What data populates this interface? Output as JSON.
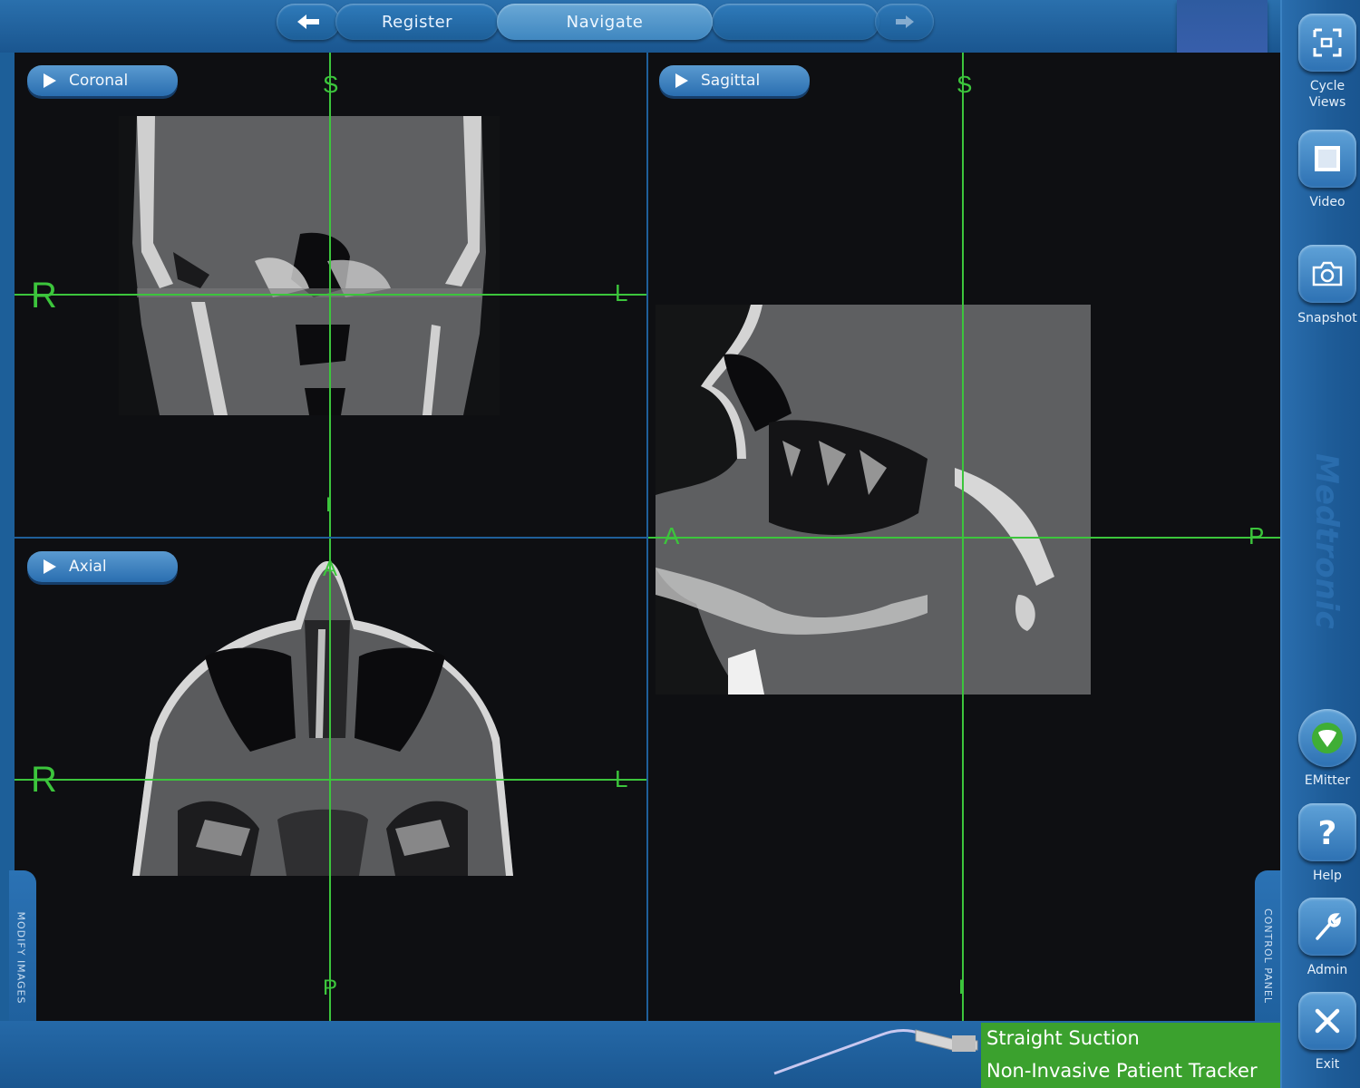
{
  "topbar": {
    "register_label": "Register",
    "navigate_label": "Navigate",
    "active_tab": "Navigate"
  },
  "views": {
    "coronal": {
      "label": "Coronal",
      "orient": {
        "top": "S",
        "left": "R",
        "right": "L",
        "bottom": "I"
      }
    },
    "sagittal": {
      "label": "Sagittal",
      "orient": {
        "top": "S",
        "left": "A",
        "right": "P",
        "bottom": "I"
      }
    },
    "axial": {
      "label": "Axial",
      "orient": {
        "top": "A",
        "left": "R",
        "right": "L",
        "bottom": "P"
      }
    }
  },
  "sidebar": {
    "buttons": [
      {
        "label": "Cycle\nViews",
        "icon": "cycle-views-icon"
      },
      {
        "label": "Video",
        "icon": "video-icon"
      },
      {
        "label": "Snapshot",
        "icon": "camera-icon"
      },
      {
        "label": "EMitter",
        "icon": "emitter-icon"
      },
      {
        "label": "Help",
        "icon": "help-icon"
      },
      {
        "label": "Admin",
        "icon": "wrench-icon"
      },
      {
        "label": "Exit",
        "icon": "close-icon"
      }
    ],
    "brand": "Medtronic"
  },
  "side_tabs": {
    "left": "MODIFY IMAGES",
    "right": "CONTROL PANEL"
  },
  "instrument": {
    "name": "Straight Suction",
    "tracker": "Non-Invasive Patient Tracker"
  },
  "colors": {
    "crosshair": "#3cc53c",
    "chrome_blue": "#1d5f99",
    "status_green": "#3ba12e"
  }
}
